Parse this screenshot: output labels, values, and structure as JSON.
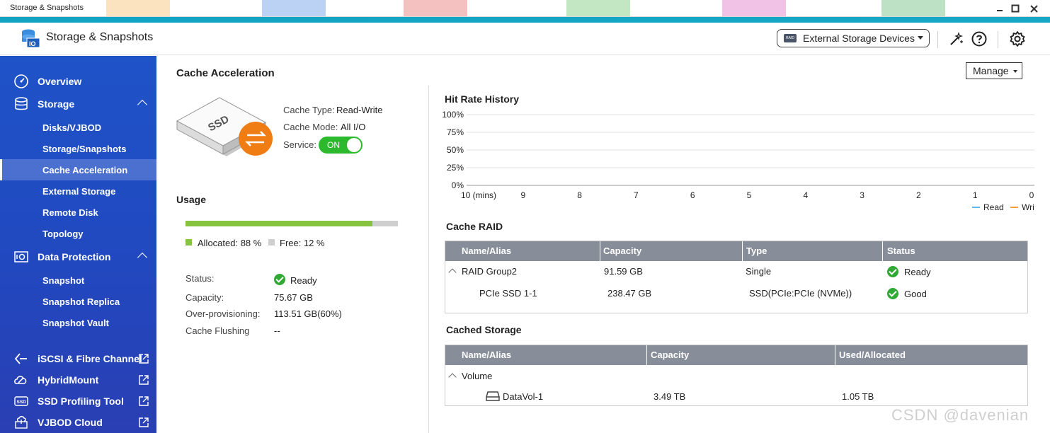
{
  "window": {
    "title": "Storage & Snapshots"
  },
  "header": {
    "app_title": "Storage & Snapshots",
    "external_devices_label": "External Storage Devices",
    "hdd_badge": "RAID"
  },
  "sidebar": {
    "overview": "Overview",
    "storage": "Storage",
    "storage_items": [
      "Disks/VJBOD",
      "Storage/Snapshots",
      "Cache Acceleration",
      "External Storage",
      "Remote Disk",
      "Topology"
    ],
    "data_protection": "Data Protection",
    "data_protection_items": [
      "Snapshot",
      "Snapshot Replica",
      "Snapshot Vault"
    ],
    "external_apps": [
      "iSCSI & Fibre Channel",
      "HybridMount",
      "SSD Profiling Tool",
      "VJBOD Cloud"
    ],
    "ssd_icon_text": "SSD"
  },
  "main": {
    "title": "Cache Acceleration",
    "manage_label": "Manage",
    "ssd_text": "SSD",
    "cache_type_label": "Cache Type:",
    "cache_type_value": "Read-Write",
    "cache_mode_label": "Cache Mode:",
    "cache_mode_value": "All I/O",
    "service_label": "Service:",
    "service_toggle": "ON",
    "usage_title": "Usage",
    "allocated_percent": 88,
    "allocated_label": "Allocated: 88 %",
    "free_label": "Free: 12 %",
    "status_label": "Status:",
    "status_value": "Ready",
    "capacity_label": "Capacity:",
    "capacity_value": "75.67 GB",
    "overprov_label": "Over-provisioning:",
    "overprov_value": "113.51 GB(60%)",
    "flushing_label": "Cache Flushing",
    "flushing_value": "--",
    "colors": {
      "sidebar": "#2148bf",
      "accent": "#12a3c3",
      "ok": "#31a935",
      "allocated": "#86c440",
      "free": "#cfcfcf",
      "table_header": "#878d99"
    }
  },
  "chart_data": {
    "type": "line",
    "title": "Hit Rate History",
    "y_ticks": [
      "100%",
      "75%",
      "50%",
      "25%",
      "0%"
    ],
    "x_ticks": [
      "10 (mins)",
      "9",
      "8",
      "7",
      "6",
      "5",
      "4",
      "3",
      "2",
      "1",
      "0"
    ],
    "ylim": [
      0,
      100
    ],
    "series": [
      {
        "name": "Read",
        "color": "#5bb9f0",
        "values": []
      },
      {
        "name": "Write",
        "color": "#f5a23c",
        "values": []
      }
    ],
    "legend": "bottom-right",
    "grid": true
  },
  "cache_raid": {
    "title": "Cache RAID",
    "columns": [
      "Name/Alias",
      "Capacity",
      "Type",
      "Status"
    ],
    "rows": [
      {
        "name": "RAID Group2",
        "capacity": "91.59 GB",
        "type": "Single",
        "status": "Ready"
      },
      {
        "name": "PCIe SSD 1-1",
        "capacity": "238.47 GB",
        "type": "SSD(PCIe:PCIe (NVMe))",
        "status": "Good"
      }
    ]
  },
  "cached_storage": {
    "title": "Cached Storage",
    "columns": [
      "Name/Alias",
      "Capacity",
      "Used/Allocated"
    ],
    "group": "Volume",
    "rows": [
      {
        "name": "DataVol-1",
        "capacity": "3.49 TB",
        "used": "1.05 TB"
      }
    ]
  },
  "watermark": "CSDN @davenian"
}
